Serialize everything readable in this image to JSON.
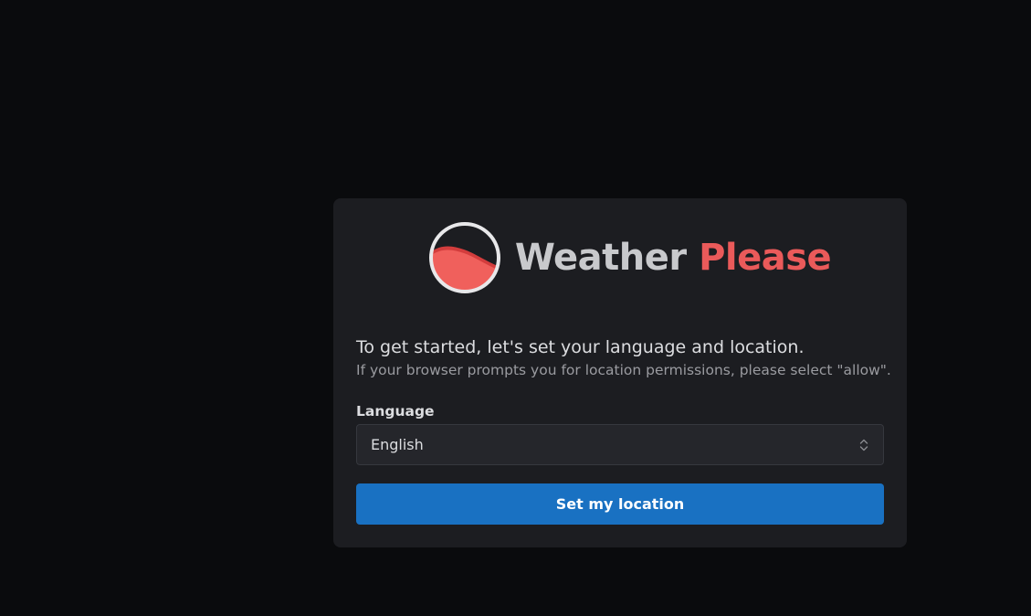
{
  "app": {
    "name_part1": "Weather",
    "name_part2": "Please",
    "logo_icon": "half-filled-circle-wave-icon"
  },
  "intro": {
    "title": "To get started, let's set your language and location.",
    "subtitle": "If your browser prompts you for location permissions, please select \"allow\"."
  },
  "language": {
    "label": "Language",
    "selected": "English",
    "icon": "chevron-updown-icon"
  },
  "actions": {
    "set_location_label": "Set my location"
  },
  "colors": {
    "background": "#0a0b0d",
    "card": "#1c1d21",
    "accent_red": "#ea5a5a",
    "button_blue": "#1971c2"
  }
}
